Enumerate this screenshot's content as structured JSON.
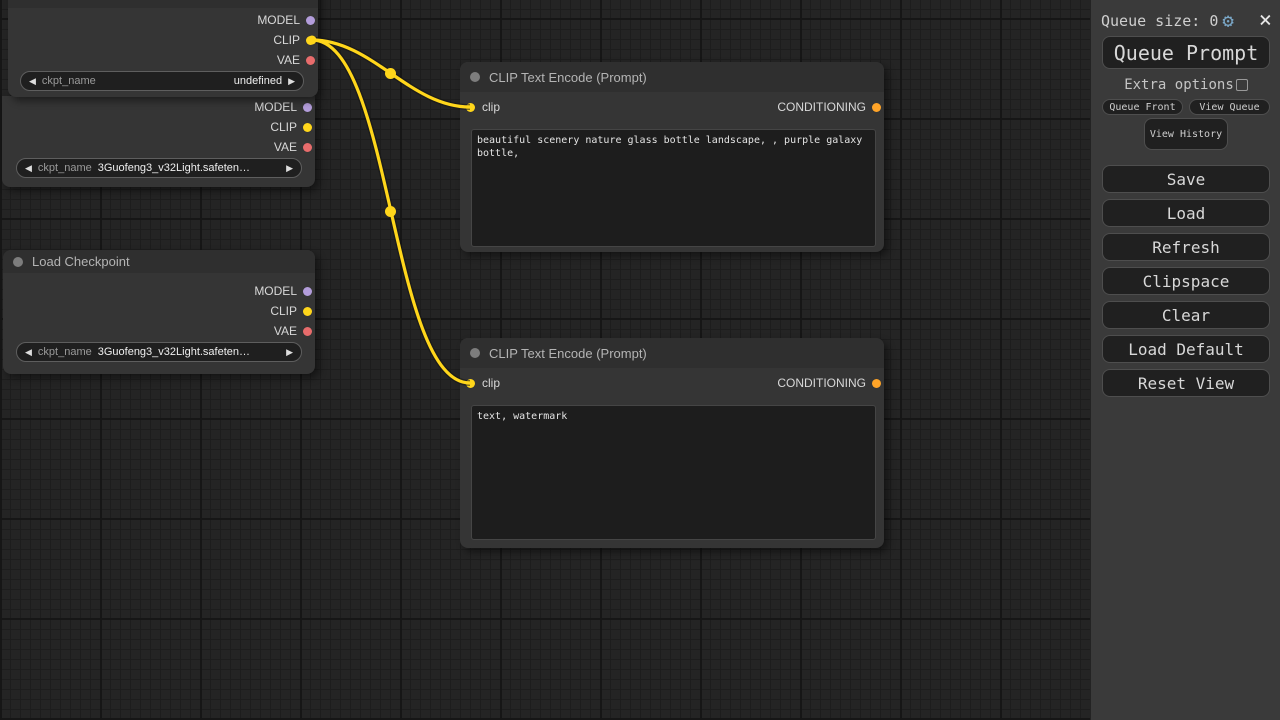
{
  "nodes": {
    "checkpoint_a": {
      "outputs": [
        "MODEL",
        "CLIP",
        "VAE"
      ],
      "widget": {
        "name": "ckpt_name",
        "value": "undefined",
        "prev": "◀",
        "next": "▶"
      }
    },
    "checkpoint_b": {
      "outputs": [
        "MODEL",
        "CLIP",
        "VAE"
      ],
      "widget": {
        "name": "ckpt_name",
        "value": "3Guofeng3_v32Light.safeten…",
        "prev": "◀",
        "next": "▶"
      }
    },
    "checkpoint_c": {
      "title": "Load Checkpoint",
      "outputs": [
        "MODEL",
        "CLIP",
        "VAE"
      ],
      "widget": {
        "name": "ckpt_name",
        "value": "3Guofeng3_v32Light.safeten…",
        "prev": "◀",
        "next": "▶"
      }
    },
    "clip_positive": {
      "title": "CLIP Text Encode (Prompt)",
      "input": "clip",
      "output": "CONDITIONING",
      "text": "beautiful scenery nature glass bottle landscape, , purple galaxy bottle,"
    },
    "clip_negative": {
      "title": "CLIP Text Encode (Prompt)",
      "input": "clip",
      "output": "CONDITIONING",
      "text": "text, watermark"
    }
  },
  "menu": {
    "queue_size": "Queue size: 0",
    "icons": {
      "settings": "⚙",
      "close": "×"
    },
    "queue_prompt": "Queue Prompt",
    "extra_options": "Extra options",
    "queue_front": "Queue Front",
    "view_queue": "View Queue",
    "view_history": "View History",
    "buttons": [
      "Save",
      "Load",
      "Refresh",
      "Clipspace",
      "Clear",
      "Load Default",
      "Reset View"
    ]
  },
  "colors": {
    "wire": "#ffd61b",
    "slot_model": "#b39ddb",
    "slot_clip": "#ffd61b",
    "slot_vae": "#e86c6c",
    "slot_conditioning": "#ffa428",
    "gear_blue": "#7aa7c7",
    "panel_bg": "#3a3a3a",
    "node_bg": "#353535",
    "canvas_bg": "#242424"
  }
}
